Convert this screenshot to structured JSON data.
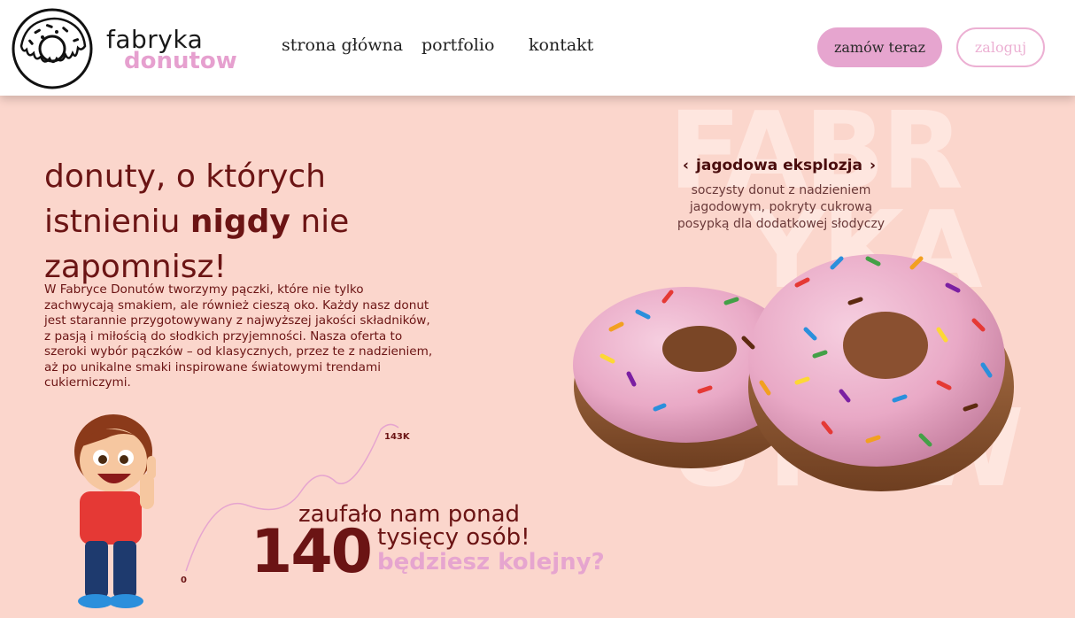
{
  "header": {
    "brand_top": "fabryka",
    "brand_bottom": "donutow",
    "nav": [
      "strona główna",
      "portfolio",
      "kontakt"
    ],
    "order_button": "zamów teraz",
    "login_button": "zaloguj"
  },
  "watermark": [
    "FABR",
    "YKA",
    "DON",
    "UTOW"
  ],
  "hero": {
    "title_part1": "donuty, o których istnieniu ",
    "title_bold": "nigdy",
    "title_part2": " nie zapomnisz!",
    "body": "W Fabryce Donutów tworzymy pączki, które nie tylko zachwycają smakiem, ale również cieszą oko. Każdy nasz donut jest starannie przygotowywany z najwyższej jakości składników, z pasją i miłością do słodkich przyjemności. Nasza oferta to szeroki wybór pączków – od klasycznych, przez te z nadzieniem, aż po unikalne smaki inspirowane światowymi trendami cukierniczymi."
  },
  "carousel": {
    "prev_arrow": "‹",
    "next_arrow": "›",
    "title": "jagodowa eksplozja",
    "description": "soczysty donut z nadzieniem jagodowym, pokryty cukrową posypką dla dodatkowej słodyczy"
  },
  "stats": {
    "trend_start": "0",
    "trend_end": "143K",
    "line1": "zaufało nam ponad",
    "number": "140",
    "line2": "tysięcy osób!",
    "line3": "będziesz kolejny?"
  },
  "colors": {
    "background": "#fbd6cc",
    "accent_pink": "#e6a5cf",
    "dark_red": "#6b1414"
  }
}
